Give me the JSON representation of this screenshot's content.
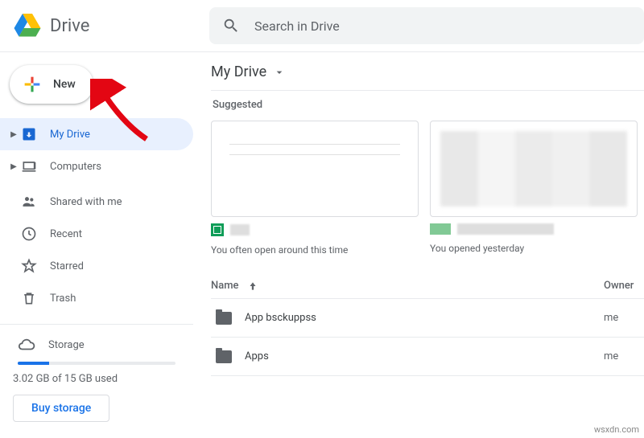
{
  "header": {
    "app_name": "Drive",
    "search_placeholder": "Search in Drive"
  },
  "sidebar": {
    "new_button": "New",
    "items": [
      {
        "id": "my-drive",
        "label": "My Drive",
        "active": true,
        "expandable": true
      },
      {
        "id": "computers",
        "label": "Computers",
        "active": false,
        "expandable": true
      },
      {
        "id": "shared",
        "label": "Shared with me",
        "active": false,
        "expandable": false
      },
      {
        "id": "recent",
        "label": "Recent",
        "active": false,
        "expandable": false
      },
      {
        "id": "starred",
        "label": "Starred",
        "active": false,
        "expandable": false
      },
      {
        "id": "trash",
        "label": "Trash",
        "active": false,
        "expandable": false
      }
    ],
    "storage_label": "Storage",
    "storage_used_text": "3.02 GB of 15 GB used",
    "storage_percent": 20,
    "buy_button": "Buy storage"
  },
  "main": {
    "breadcrumb": "My Drive",
    "suggested_label": "Suggested",
    "suggested": [
      {
        "caption": "You often open around this time",
        "type": "sheets"
      },
      {
        "caption": "You opened yesterday",
        "type": "generic"
      }
    ],
    "table": {
      "columns": {
        "name": "Name",
        "owner": "Owner"
      },
      "rows": [
        {
          "name": "App bsckuppss",
          "owner": "me"
        },
        {
          "name": "Apps",
          "owner": "me"
        }
      ]
    }
  },
  "watermark": "wsxdn.com"
}
